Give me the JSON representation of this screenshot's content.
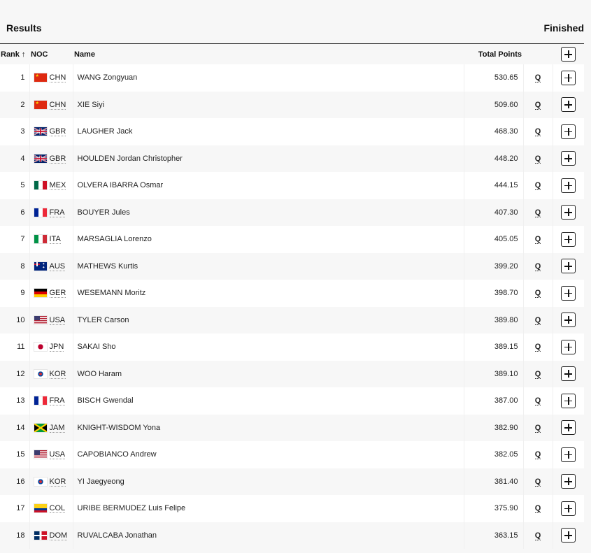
{
  "header": {
    "title": "Results",
    "status": "Finished"
  },
  "table": {
    "columns": {
      "rank": "Rank",
      "sort_indicator": "↑",
      "noc": "NOC",
      "name": "Name",
      "total_points": "Total Points"
    },
    "rows": [
      {
        "rank": "1",
        "noc": "CHN",
        "flag": "china-flag",
        "name": "WANG Zongyuan",
        "points": "530.65",
        "qual": "Q"
      },
      {
        "rank": "2",
        "noc": "CHN",
        "flag": "china-flag",
        "name": "XIE Siyi",
        "points": "509.60",
        "qual": "Q"
      },
      {
        "rank": "3",
        "noc": "GBR",
        "flag": "uk-flag",
        "name": "LAUGHER Jack",
        "points": "468.30",
        "qual": "Q"
      },
      {
        "rank": "4",
        "noc": "GBR",
        "flag": "uk-flag",
        "name": "HOULDEN Jordan Christopher",
        "points": "448.20",
        "qual": "Q"
      },
      {
        "rank": "5",
        "noc": "MEX",
        "flag": "mexico-flag",
        "name": "OLVERA IBARRA Osmar",
        "points": "444.15",
        "qual": "Q"
      },
      {
        "rank": "6",
        "noc": "FRA",
        "flag": "france-flag",
        "name": "BOUYER Jules",
        "points": "407.30",
        "qual": "Q"
      },
      {
        "rank": "7",
        "noc": "ITA",
        "flag": "italy-flag",
        "name": "MARSAGLIA Lorenzo",
        "points": "405.05",
        "qual": "Q"
      },
      {
        "rank": "8",
        "noc": "AUS",
        "flag": "australia-flag",
        "name": "MATHEWS Kurtis",
        "points": "399.20",
        "qual": "Q"
      },
      {
        "rank": "9",
        "noc": "GER",
        "flag": "germany-flag",
        "name": "WESEMANN Moritz",
        "points": "398.70",
        "qual": "Q"
      },
      {
        "rank": "10",
        "noc": "USA",
        "flag": "usa-flag",
        "name": "TYLER Carson",
        "points": "389.80",
        "qual": "Q"
      },
      {
        "rank": "11",
        "noc": "JPN",
        "flag": "japan-flag",
        "name": "SAKAI Sho",
        "points": "389.15",
        "qual": "Q"
      },
      {
        "rank": "12",
        "noc": "KOR",
        "flag": "korea-flag",
        "name": "WOO Haram",
        "points": "389.10",
        "qual": "Q"
      },
      {
        "rank": "13",
        "noc": "FRA",
        "flag": "france-flag",
        "name": "BISCH Gwendal",
        "points": "387.00",
        "qual": "Q"
      },
      {
        "rank": "14",
        "noc": "JAM",
        "flag": "jamaica-flag",
        "name": "KNIGHT-WISDOM Yona",
        "points": "382.90",
        "qual": "Q"
      },
      {
        "rank": "15",
        "noc": "USA",
        "flag": "usa-flag",
        "name": "CAPOBIANCO Andrew",
        "points": "382.05",
        "qual": "Q"
      },
      {
        "rank": "16",
        "noc": "KOR",
        "flag": "korea-flag",
        "name": "YI Jaegyeong",
        "points": "381.40",
        "qual": "Q"
      },
      {
        "rank": "17",
        "noc": "COL",
        "flag": "colombia-flag",
        "name": "URIBE BERMUDEZ Luis Felipe",
        "points": "375.90",
        "qual": "Q"
      },
      {
        "rank": "18",
        "noc": "DOM",
        "flag": "dominican-republic-flag",
        "name": "RUVALCABA Jonathan",
        "points": "363.15",
        "qual": "Q"
      }
    ]
  }
}
